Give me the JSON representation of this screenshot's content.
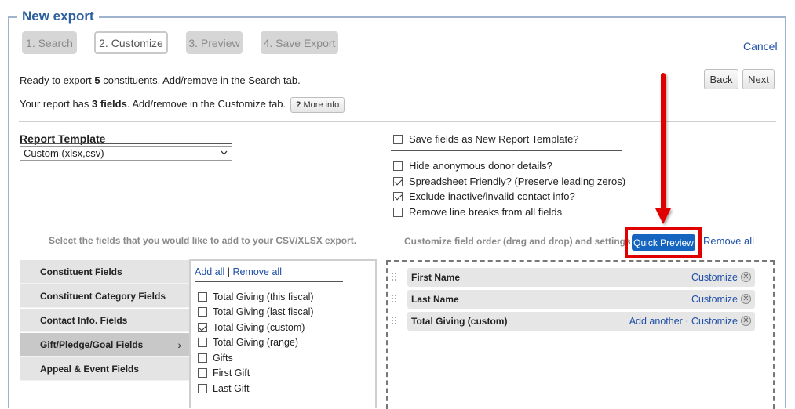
{
  "title": "New export",
  "steps": [
    "1. Search",
    "2. Customize",
    "3. Preview",
    "4. Save Export"
  ],
  "active_step": 1,
  "cancel_label": "Cancel",
  "back_label": "Back",
  "next_label": "Next",
  "info": {
    "line1_pre": "Ready to export ",
    "line1_count": "5",
    "line1_post": " constituents. Add/remove in the Search tab.",
    "line2_pre": "Your report has ",
    "line2_count": "3 fields",
    "line2_post": ". Add/remove in the Customize tab.",
    "more_info": "More info"
  },
  "report_template": {
    "label": "Report Template",
    "selected": "Custom (xlsx,csv)"
  },
  "options": {
    "save_template": {
      "label": "Save fields as New Report Template?",
      "checked": false
    },
    "hide_anonymous": {
      "label": "Hide anonymous donor details?",
      "checked": false
    },
    "spreadsheet_friendly": {
      "label": "Spreadsheet Friendly? (Preserve leading zeros)",
      "checked": true
    },
    "exclude_inactive": {
      "label": "Exclude inactive/invalid contact info?",
      "checked": true
    },
    "remove_line_breaks": {
      "label": "Remove line breaks from all fields",
      "checked": false
    }
  },
  "left_instruction": "Select the fields that you would like to add to your CSV/XLSX export.",
  "right_instruction": "Customize field order (drag and drop) and settings",
  "quick_preview": "Quick Preview",
  "remove_all": "Remove all",
  "categories": [
    {
      "label": "Constituent Fields",
      "selected": false
    },
    {
      "label": "Constituent Category Fields",
      "selected": false
    },
    {
      "label": "Contact Info. Fields",
      "selected": false
    },
    {
      "label": "Gift/Pledge/Goal Fields",
      "selected": true
    },
    {
      "label": "Appeal & Event Fields",
      "selected": false
    }
  ],
  "field_list": {
    "add_all": "Add all",
    "separator": "|",
    "remove_all": "Remove all",
    "items": [
      {
        "label": "Total Giving (this fiscal)",
        "checked": false
      },
      {
        "label": "Total Giving (last fiscal)",
        "checked": false
      },
      {
        "label": "Total Giving (custom)",
        "checked": true
      },
      {
        "label": "Total Giving (range)",
        "checked": false
      },
      {
        "label": "Gifts",
        "checked": false
      },
      {
        "label": "First Gift",
        "checked": false
      },
      {
        "label": "Last Gift",
        "checked": false
      }
    ]
  },
  "selected_fields": [
    {
      "label": "First Name",
      "add_another": "",
      "customize": "Customize"
    },
    {
      "label": "Last Name",
      "add_another": "",
      "customize": "Customize"
    },
    {
      "label": "Total Giving (custom)",
      "add_another": "Add another",
      "customize": "Customize"
    }
  ],
  "colors": {
    "title": "#2b5f9e",
    "link": "#1f4fa8",
    "quick_preview_bg": "#1565c0",
    "highlight": "#e00000"
  }
}
